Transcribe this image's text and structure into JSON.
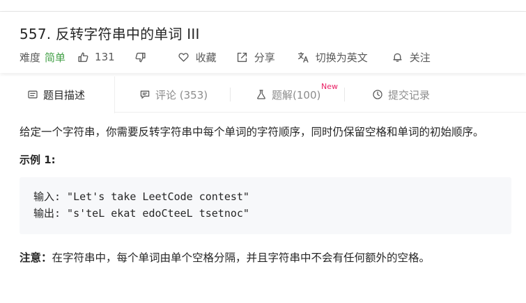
{
  "problem": {
    "title": "557. 反转字符串中的单词 III"
  },
  "meta": {
    "difficulty_label": "难度",
    "difficulty_value": "简单",
    "difficulty_color": "#43a047",
    "likes": "131",
    "favorite_label": "收藏",
    "share_label": "分享",
    "switch_lang_label": "切换为英文",
    "follow_label": "关注"
  },
  "tabs": [
    {
      "label": "题目描述",
      "icon": "description-icon",
      "active": true
    },
    {
      "label": "评论 (353)",
      "icon": "comment-icon",
      "active": false
    },
    {
      "label": "题解(100)",
      "icon": "flask-icon",
      "active": false,
      "badge": "New"
    },
    {
      "label": "提交记录",
      "icon": "clock-icon",
      "active": false
    }
  ],
  "content": {
    "description": "给定一个字符串，你需要反转字符串中每个单词的字符顺序，同时仍保留空格和单词的初始顺序。",
    "example_title": "示例 1:",
    "code_lines": [
      "输入: \"Let's take LeetCode contest\"",
      "输出: \"s'teL ekat edoCteeL tsetnoc\""
    ],
    "note_label": "注意：",
    "note_text": "在字符串中，每个单词由单个空格分隔，并且字符串中不会有任何额外的空格。"
  },
  "colors": {
    "badge_new": "#e91e63",
    "code_background": "#f7f8fa"
  }
}
